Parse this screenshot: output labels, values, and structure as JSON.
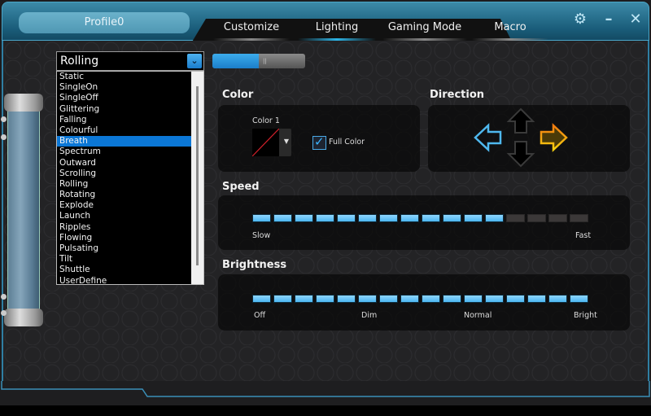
{
  "titlebar": {
    "profile_name": "Profile0",
    "tabs": [
      {
        "label": "Customize",
        "active": false
      },
      {
        "label": "Lighting",
        "active": true
      },
      {
        "label": "Gaming Mode",
        "active": false
      },
      {
        "label": "Macro",
        "active": false
      }
    ],
    "settings_icon": "⚙",
    "minimize_icon": "–",
    "close_icon": "✕"
  },
  "effect": {
    "selected_value": "Rolling",
    "dropdown_arrow": "⌄",
    "highlighted_item": "Breath",
    "options": [
      "Static",
      "SingleOn",
      "SingleOff",
      "Glittering",
      "Falling",
      "Colourful",
      "Breath",
      "Spectrum",
      "Outward",
      "Scrolling",
      "Rolling",
      "Rotating",
      "Explode",
      "Launch",
      "Ripples",
      "Flowing",
      "Pulsating",
      "Tilt",
      "Shuttle",
      "UserDefine"
    ]
  },
  "mode_toggle": {
    "grip": "||",
    "fill_fraction": 0.5
  },
  "color": {
    "title": "Color",
    "color1_label": "Color 1",
    "swatch_dropdown": "▼",
    "full_color_label": "Full Color",
    "full_color_checked": true,
    "check_mark": "✓"
  },
  "direction": {
    "title": "Direction",
    "left_color": "#4fb8ee",
    "right_color": "#f0a020",
    "selected": "right"
  },
  "speed": {
    "title": "Speed",
    "segments_total": 16,
    "segments_filled": 12,
    "min_label": "Slow",
    "max_label": "Fast"
  },
  "brightness": {
    "title": "Brightness",
    "segments_total": 16,
    "segments_filled": 16,
    "labels": [
      "Off",
      "Dim",
      "Normal",
      "Bright"
    ]
  },
  "colors": {
    "accent": "#2db4e6",
    "segment_on": "#6cc6f7",
    "segment_off": "#3b3838",
    "list_highlight": "#0b77d6"
  }
}
